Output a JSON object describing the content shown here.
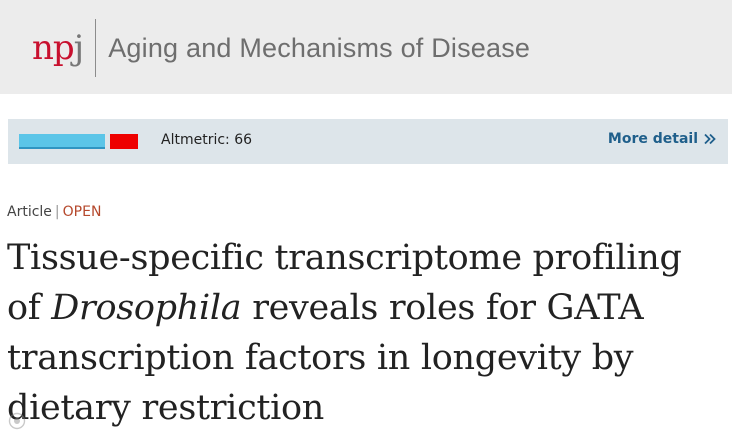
{
  "header": {
    "logo": {
      "n": "n",
      "p": "p",
      "j": "j",
      "brand_color": "#c8102e",
      "j_color": "#777777"
    },
    "journal_title": "Aging and Mechanisms of Disease"
  },
  "altmetric": {
    "score_label": "Altmetric: 66",
    "detail_link": "More detail",
    "badge_colors": [
      "#5bc5e8",
      "#ee0000"
    ],
    "link_color": "#1f5f8b"
  },
  "article": {
    "type": "Article",
    "separator": "|",
    "access": "OPEN",
    "access_color": "#b5482c",
    "title_part1": "Tissue-specific transcriptome profiling of ",
    "title_italic": "Drosophila",
    "title_part2": " reveals roles for GATA transcription factors in longevity by dietary restriction"
  },
  "icons": {
    "more_detail": "double-chevron-right-icon",
    "watermark": "watermark-icon"
  }
}
